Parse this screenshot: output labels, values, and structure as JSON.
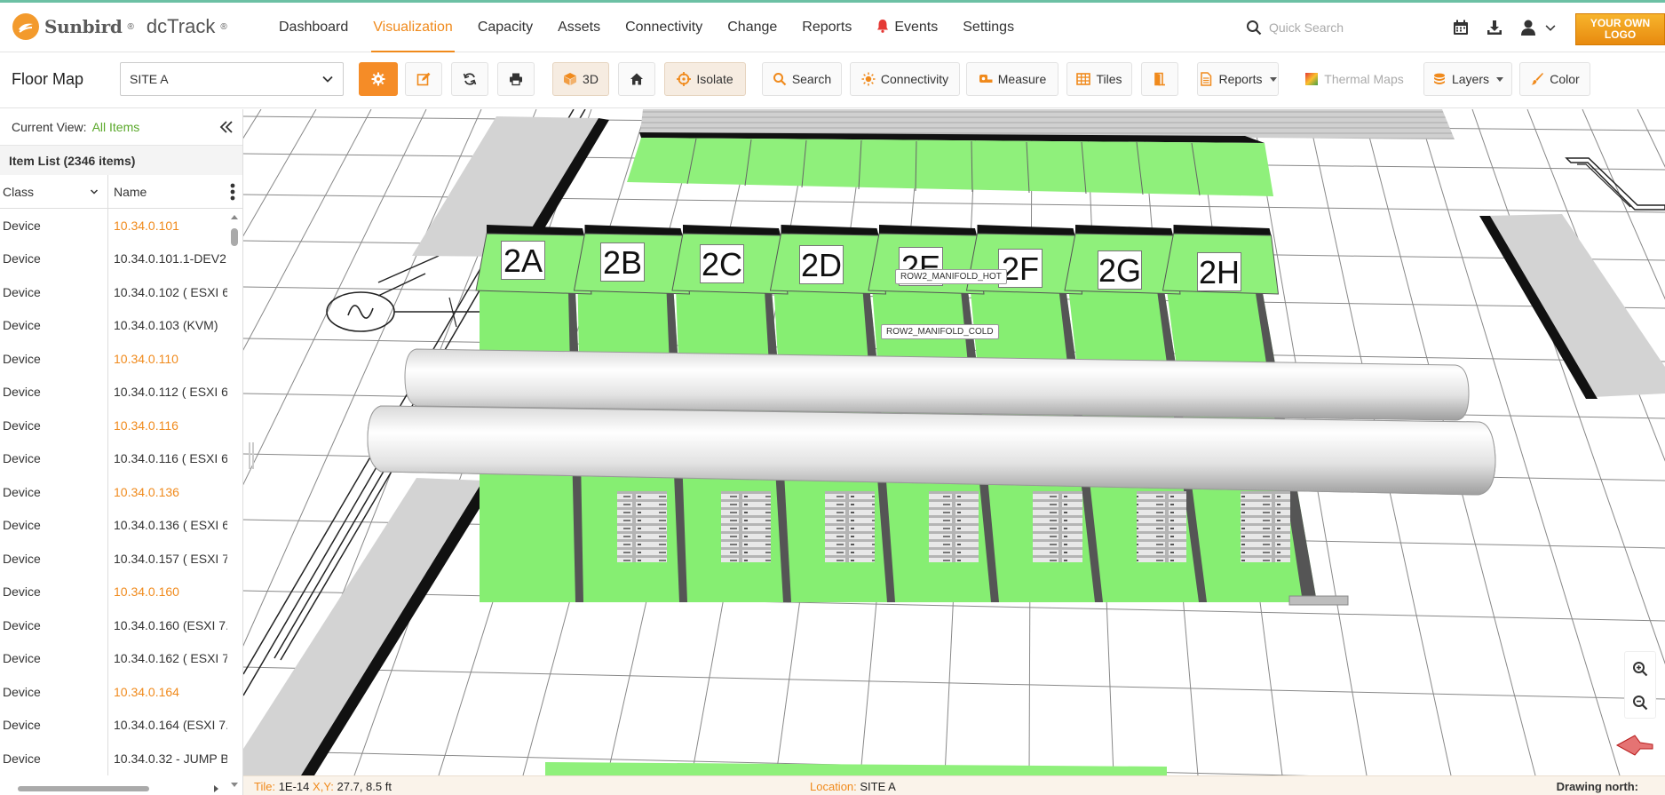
{
  "app": {
    "brand": "Sunbird",
    "product": "dcTrack",
    "custom_logo": "YOUR OWN LOGO"
  },
  "nav": {
    "items": [
      {
        "label": "Dashboard"
      },
      {
        "label": "Visualization"
      },
      {
        "label": "Capacity"
      },
      {
        "label": "Assets"
      },
      {
        "label": "Connectivity"
      },
      {
        "label": "Change"
      },
      {
        "label": "Reports"
      },
      {
        "label": "Events"
      },
      {
        "label": "Settings"
      }
    ],
    "active": "Visualization",
    "search_placeholder": "Quick Search"
  },
  "toolbar": {
    "page_title": "Floor Map",
    "site": "SITE A",
    "threed": "3D",
    "isolate": "Isolate",
    "search": "Search",
    "connectivity": "Connectivity",
    "measure": "Measure",
    "tiles": "Tiles",
    "reports": "Reports",
    "thermal": "Thermal Maps",
    "layers": "Layers",
    "color": "Color"
  },
  "panel": {
    "current_view_label": "Current View:",
    "current_view_value": "All Items",
    "item_list_title": "Item List (2346 items)",
    "col_class": "Class",
    "col_name": "Name",
    "rows": [
      {
        "cls": "Device",
        "name": "10.34.0.101",
        "hl": true
      },
      {
        "cls": "Device",
        "name": "10.34.0.101.1-DEV2",
        "hl": false
      },
      {
        "cls": "Device",
        "name": "10.34.0.102 ( ESXI 6.",
        "hl": false
      },
      {
        "cls": "Device",
        "name": "10.34.0.103 (KVM)",
        "hl": false
      },
      {
        "cls": "Device",
        "name": "10.34.0.110",
        "hl": true
      },
      {
        "cls": "Device",
        "name": "10.34.0.112 ( ESXI 6.",
        "hl": false
      },
      {
        "cls": "Device",
        "name": "10.34.0.116",
        "hl": true
      },
      {
        "cls": "Device",
        "name": "10.34.0.116 ( ESXI 6.",
        "hl": false
      },
      {
        "cls": "Device",
        "name": "10.34.0.136",
        "hl": true
      },
      {
        "cls": "Device",
        "name": "10.34.0.136 ( ESXI 6.",
        "hl": false
      },
      {
        "cls": "Device",
        "name": "10.34.0.157 ( ESXI 7.",
        "hl": false
      },
      {
        "cls": "Device",
        "name": "10.34.0.160",
        "hl": true
      },
      {
        "cls": "Device",
        "name": "10.34.0.160 (ESXI 7.(",
        "hl": false
      },
      {
        "cls": "Device",
        "name": "10.34.0.162 ( ESXI 7.",
        "hl": false
      },
      {
        "cls": "Device",
        "name": "10.34.0.164",
        "hl": true
      },
      {
        "cls": "Device",
        "name": "10.34.0.164 (ESXI 7.(",
        "hl": false
      },
      {
        "cls": "Device",
        "name": "10.34.0.32 - JUMP B",
        "hl": false
      }
    ]
  },
  "map": {
    "racks": [
      "2A",
      "2B",
      "2C",
      "2D",
      "2E",
      "2F",
      "2G",
      "2H"
    ],
    "hot_manifold": "ROW2_MANIFOLD_HOT",
    "cold_manifold": "ROW2_MANIFOLD_COLD"
  },
  "status": {
    "tile_label": "Tile:",
    "tile_value": "1E-14",
    "xy_label": "X,Y:",
    "xy_value": "27.7, 8.5 ft",
    "location_label": "Location:",
    "location_value": "SITE A",
    "drawing_north": "Drawing north:"
  }
}
